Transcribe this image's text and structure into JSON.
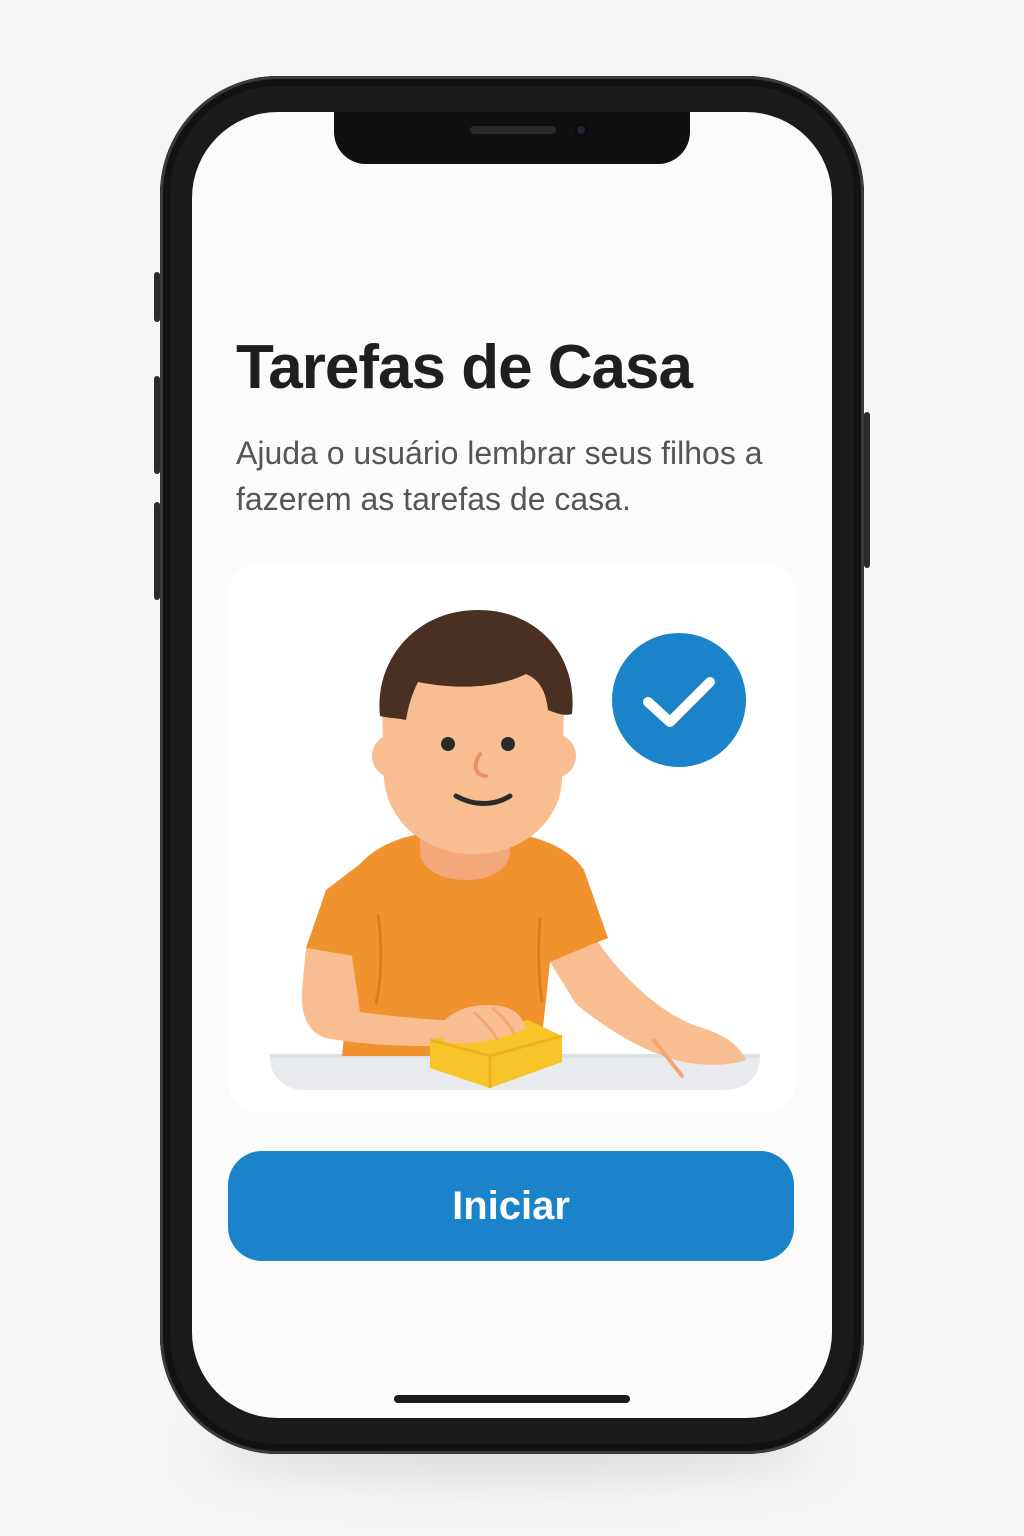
{
  "app": {
    "title": "Tarefas de Casa",
    "description": "Ajuda o usuário lembrar seus filhos a fazerem as tarefas de casa."
  },
  "actions": {
    "start_label": "Iniciar"
  },
  "illustration": {
    "subject": "child-cleaning-table",
    "badge_icon": "check-icon"
  },
  "colors": {
    "accent": "#1A83C9",
    "shirt": "#F0922E",
    "skin": "#F8BE91",
    "hair": "#4A3023",
    "sponge": "#F7C52A",
    "table": "#E8EAED",
    "title": "#1F1F1F",
    "subtitle": "#555555"
  }
}
